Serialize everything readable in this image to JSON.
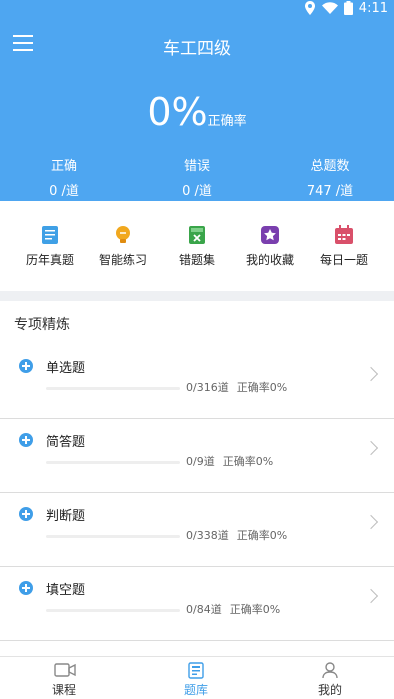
{
  "status_bar": {
    "time": "4:11"
  },
  "header": {
    "title": "车工四级",
    "menu_icon": "menu-icon"
  },
  "accuracy": {
    "value": "0%",
    "label": "正确率"
  },
  "stats": [
    {
      "label": "正确",
      "value": "0 /道"
    },
    {
      "label": "错误",
      "value": "0 /道"
    },
    {
      "label": "总题数",
      "value": "747 /道"
    }
  ],
  "quick_actions": [
    {
      "label": "历年真题",
      "icon": "book-icon",
      "color": "#3fa0e6"
    },
    {
      "label": "智能练习",
      "icon": "lightbulb-icon",
      "color": "#f1a81e"
    },
    {
      "label": "错题集",
      "icon": "wrong-book-icon",
      "color": "#3aa54a"
    },
    {
      "label": "我的收藏",
      "icon": "star-icon",
      "color": "#7a3fae"
    },
    {
      "label": "每日一题",
      "icon": "calendar-icon",
      "color": "#d9506a"
    }
  ],
  "section": {
    "title": "专项精炼"
  },
  "topics": [
    {
      "name": "单选题",
      "count": "0/316道",
      "rate": "正确率0%",
      "progress": 0
    },
    {
      "name": "简答题",
      "count": "0/9道",
      "rate": "正确率0%",
      "progress": 0
    },
    {
      "name": "判断题",
      "count": "0/338道",
      "rate": "正确率0%",
      "progress": 0
    },
    {
      "name": "填空题",
      "count": "0/84道",
      "rate": "正确率0%",
      "progress": 0
    }
  ],
  "bottom_nav": [
    {
      "label": "课程",
      "icon": "video-icon",
      "active": false
    },
    {
      "label": "题库",
      "icon": "question-bank-icon",
      "active": true
    },
    {
      "label": "我的",
      "icon": "person-icon",
      "active": false
    }
  ],
  "colors": {
    "primary": "#4ea6f1",
    "accent": "#3f9ee8"
  }
}
